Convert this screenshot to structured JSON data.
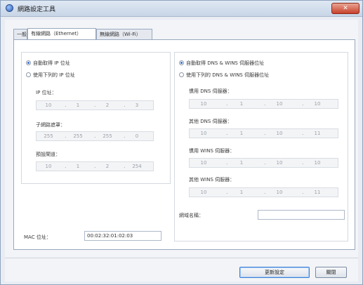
{
  "window": {
    "title": "網路設定工具",
    "close_glyph": "✕"
  },
  "tabs": [
    {
      "label": "一般",
      "active": false
    },
    {
      "label": "有線網路（Ethernet）",
      "active": true
    },
    {
      "label": "無線網路（Wi-Fi）",
      "active": false
    }
  ],
  "ip_section": {
    "auto_option": "自動取得 IP 位址",
    "manual_option": "使用下列的 IP 位址",
    "selected": "auto",
    "ip_label": "IP 位址：",
    "ip_value": [
      "10",
      "1",
      "2",
      "3"
    ],
    "subnet_label": "子網路遮罩：",
    "subnet_value": [
      "255",
      "255",
      "255",
      "0"
    ],
    "gateway_label": "預設閘道：",
    "gateway_value": [
      "10",
      "1",
      "2",
      "254"
    ]
  },
  "dns_section": {
    "auto_option": "自動取得 DNS & WINS 伺服器位址",
    "manual_option": "使用下列的 DNS & WINS 伺服器位址",
    "selected": "auto",
    "preferred_dns_label": "慣用 DNS 伺服器：",
    "preferred_dns_value": [
      "10",
      "1",
      "10",
      "10"
    ],
    "alternate_dns_label": "其他 DNS 伺服器：",
    "alternate_dns_value": [
      "10",
      "1",
      "10",
      "11"
    ],
    "preferred_wins_label": "慣用 WINS 伺服器：",
    "preferred_wins_value": [
      "10",
      "1",
      "10",
      "10"
    ],
    "alternate_wins_label": "其他 WINS 伺服器：",
    "alternate_wins_value": [
      "10",
      "1",
      "10",
      "11"
    ],
    "domain_label": "網域名稱：",
    "domain_value": ""
  },
  "mac": {
    "label": "MAC 位址：",
    "value": "00:02:32:01:02:03"
  },
  "buttons": {
    "apply": "更新設定",
    "close": "關閉"
  },
  "colors": {
    "accent": "#2f6bd6",
    "title_close": "#c8412b"
  }
}
